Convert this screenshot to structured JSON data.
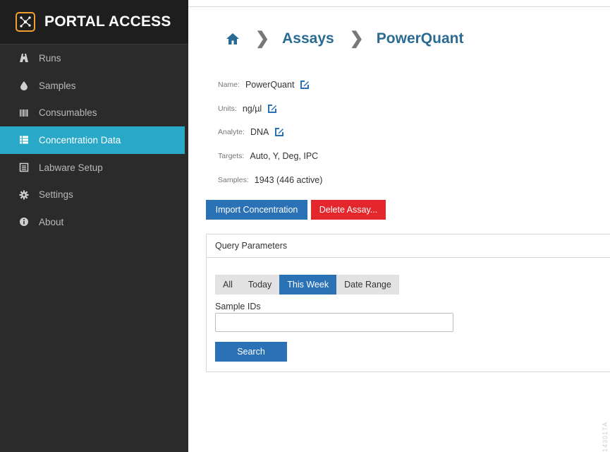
{
  "brand": {
    "title": "PORTAL ACCESS"
  },
  "sidebar": {
    "items": [
      {
        "label": "Runs",
        "icon": "road-icon",
        "active": false
      },
      {
        "label": "Samples",
        "icon": "droplet-icon",
        "active": false
      },
      {
        "label": "Consumables",
        "icon": "barcode-icon",
        "active": false
      },
      {
        "label": "Concentration Data",
        "icon": "list-icon",
        "active": true
      },
      {
        "label": "Labware Setup",
        "icon": "labware-icon",
        "active": false
      },
      {
        "label": "Settings",
        "icon": "gear-icon",
        "active": false
      },
      {
        "label": "About",
        "icon": "info-icon",
        "active": false
      }
    ]
  },
  "breadcrumb": {
    "items": [
      "Assays",
      "PowerQuant"
    ]
  },
  "meta": {
    "name_label": "Name:",
    "name_value": "PowerQuant",
    "units_label": "Units:",
    "units_value": "ng/µl",
    "analyte_label": "Analyte:",
    "analyte_value": "DNA",
    "targets_label": "Targets:",
    "targets_value": "Auto, Y, Deg, IPC",
    "samples_label": "Samples:",
    "samples_value": "1943 (446 active)"
  },
  "actions": {
    "import_label": "Import Concentration",
    "delete_label": "Delete Assay..."
  },
  "query": {
    "header": "Query Parameters",
    "ranges": [
      "All",
      "Today",
      "This Week",
      "Date Range"
    ],
    "selected_range": "This Week",
    "sample_ids_label": "Sample IDs",
    "sample_ids_value": "",
    "search_label": "Search"
  },
  "colors": {
    "accent": "#29a8c8",
    "primary": "#2a71b6",
    "danger": "#e4262d",
    "sidebar_bg": "#2b2b2b",
    "link": "#2a6b93"
  },
  "side_code": "14301TA"
}
